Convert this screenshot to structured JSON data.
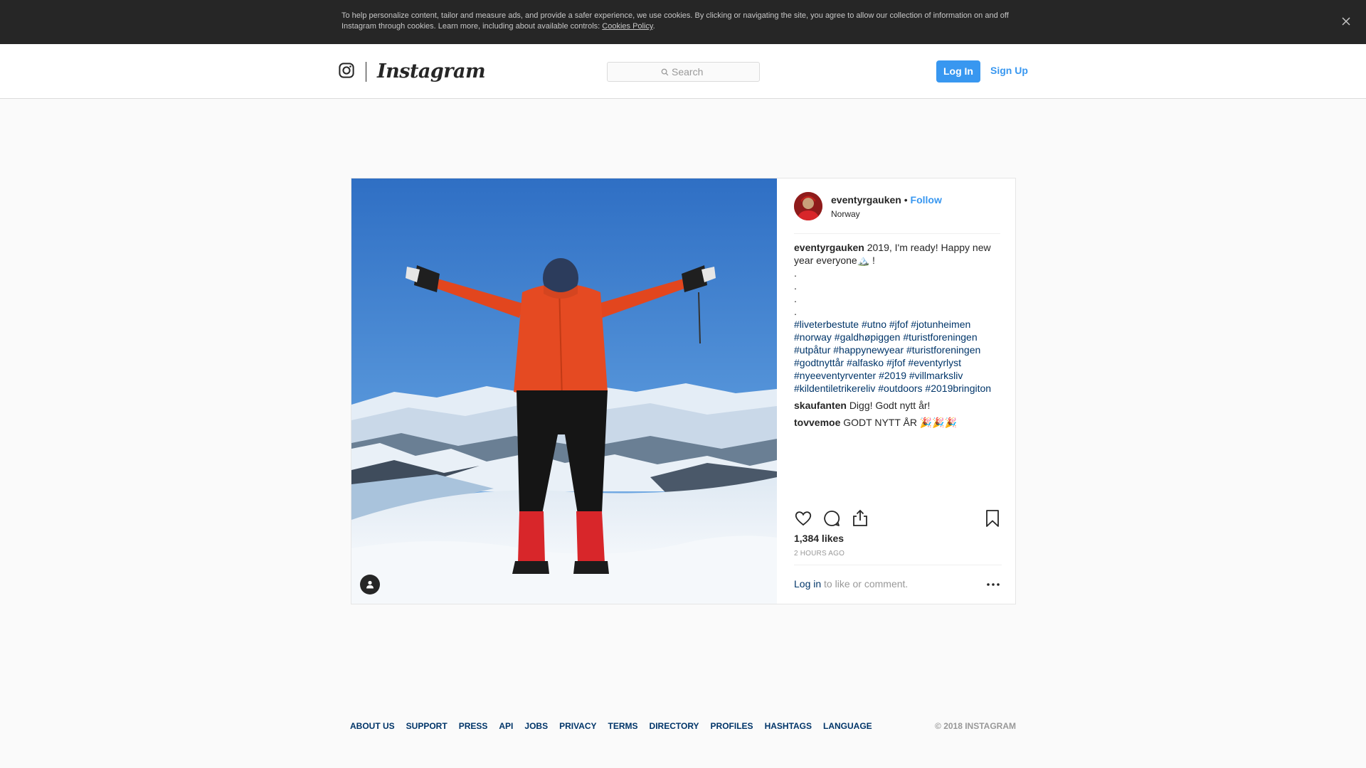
{
  "cookie_banner": {
    "text": "To help personalize content, tailor and measure ads, and provide a safer experience, we use cookies. By clicking or navigating the site, you agree to allow our collection of information on and off Instagram through cookies. Learn more, including about available controls: ",
    "link_label": "Cookies Policy",
    "suffix": ".",
    "close_icon": "close-icon"
  },
  "header": {
    "logo_text": "Instagram",
    "search_placeholder": "Search",
    "login_label": "Log In",
    "signup_label": "Sign Up"
  },
  "post": {
    "author": {
      "username": "eventyrgauken",
      "separator": "•",
      "follow_label": "Follow",
      "location": "Norway"
    },
    "caption": {
      "username": "eventyrgauken",
      "text": "2019, I'm ready! Happy new year everyone🏔️ !",
      "dots": [
        ".",
        ".",
        ".",
        "."
      ],
      "hashtags": "#liveterbestute #utno #jfof #jotunheimen #norway #galdhøpiggen #turistforeningen #utpåtur #happynewyear #turistforeningen #godtnyttår #alfasko #jfof #eventyrlyst #nyeeventyrventer #2019 #villmarksliv #kildentiletrikereliv #outdoors #2019bringiton"
    },
    "comments": [
      {
        "username": "skaufanten",
        "text": "Digg! Godt nytt år!"
      },
      {
        "username": "tovvemoe",
        "text": "GODT NYTT ÅR 🎉🎉🎉"
      }
    ],
    "likes": "1,384 likes",
    "time": "2 HOURS AGO",
    "login_prompt": {
      "link": "Log in",
      "text": " to like or comment."
    },
    "icons": {
      "like": "heart-icon",
      "comment": "comment-icon",
      "share": "share-icon",
      "save": "bookmark-icon",
      "more": "more-icon",
      "tag": "user-tag-icon"
    }
  },
  "footer": {
    "links": [
      "ABOUT US",
      "SUPPORT",
      "PRESS",
      "API",
      "JOBS",
      "PRIVACY",
      "TERMS",
      "DIRECTORY",
      "PROFILES",
      "HASHTAGS",
      "LANGUAGE"
    ],
    "copyright": "© 2018 INSTAGRAM"
  },
  "colors": {
    "accent": "#3897f0",
    "link_dark": "#003569",
    "banner": "#262626",
    "muted": "#999999"
  }
}
